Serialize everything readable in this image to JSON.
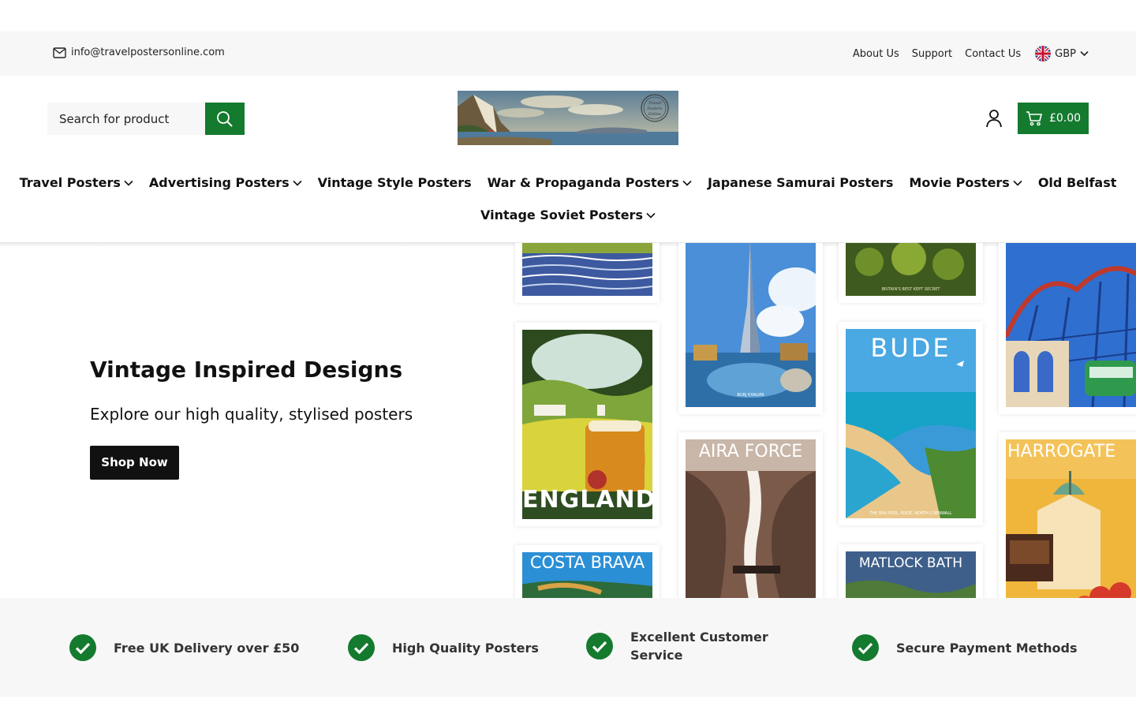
{
  "topbar": {
    "email": "info@travelpostersonline.com",
    "links": [
      "About Us",
      "Support",
      "Contact Us"
    ],
    "currency": "GBP"
  },
  "header": {
    "search_placeholder": "Search for product",
    "logo_text": "Travel Posters Online",
    "cart_total": "£0.00"
  },
  "nav": {
    "row1": [
      {
        "label": "Travel Posters",
        "dropdown": true
      },
      {
        "label": "Advertising Posters",
        "dropdown": true
      },
      {
        "label": "Vintage Style Posters",
        "dropdown": false
      },
      {
        "label": "War & Propaganda Posters",
        "dropdown": true
      },
      {
        "label": "Japanese Samurai Posters",
        "dropdown": false
      },
      {
        "label": "Movie Posters",
        "dropdown": true
      },
      {
        "label": "Old Belfast",
        "dropdown": false
      }
    ],
    "row2": [
      {
        "label": "Vintage Soviet Posters",
        "dropdown": true
      }
    ]
  },
  "hero": {
    "title": "Vintage Inspired Designs",
    "subtitle": "Explore our high quality, stylised posters",
    "cta": "Shop Now",
    "posters": {
      "england": "ENGLAND",
      "bude": "BUDE",
      "aira_force": "AIRA FORCE",
      "harrogate": "HARROGATE",
      "costa_brava": "COSTA BRAVA",
      "matlock_bath": "MATLOCK BATH",
      "burj": "BURJ KHALIFA",
      "secret": "BRITAIN'S BEST KEPT SECRET",
      "bude_caption": "THE SEA POOL, BUDE, NORTH CORNWALL"
    }
  },
  "features": [
    "Free UK Delivery over £50",
    "High Quality Posters",
    "Excellent Customer Service",
    "Secure Payment Methods"
  ],
  "colors": {
    "brand_green": "#147a2e",
    "topbar_bg": "#f7f7f7",
    "button_dark": "#111111"
  }
}
